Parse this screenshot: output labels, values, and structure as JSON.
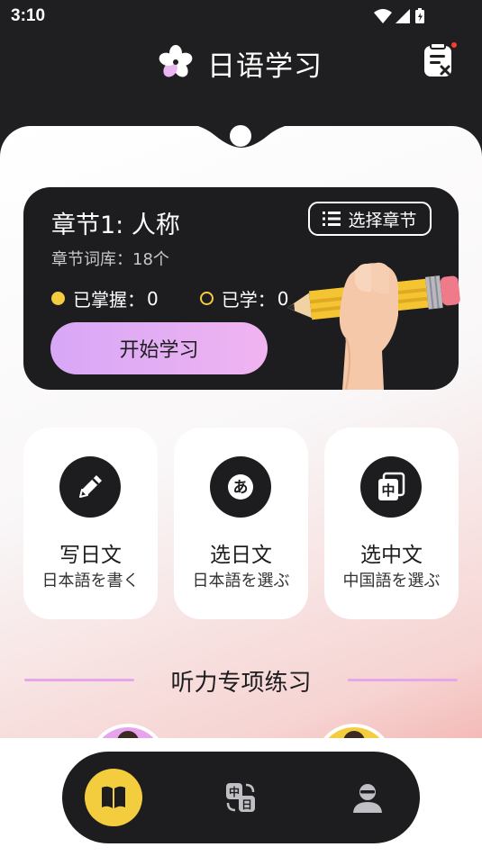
{
  "status_bar": {
    "time": "3:10",
    "icons": [
      "wifi-icon",
      "signal-icon",
      "battery-icon"
    ]
  },
  "header": {
    "title": "日语学习",
    "logo_icon": "flower-icon",
    "right_icon": "notes-icon"
  },
  "chapter_card": {
    "title": "章节1: 人称",
    "select_button_label": "选择章节",
    "word_count_text": "章节词库：18个",
    "mastered_label": "已掌握：",
    "mastered_value": "0",
    "learned_label": "已学：",
    "learned_value": "0",
    "start_button_label": "开始学习"
  },
  "practice_cards": [
    {
      "title": "写日文",
      "subtitle": "日本語を書く",
      "icon": "pencil-icon"
    },
    {
      "title": "选日文",
      "subtitle": "日本語を選ぶ",
      "icon": "hiragana-a-icon"
    },
    {
      "title": "选中文",
      "subtitle": "中国語を選ぶ",
      "icon": "chinese-char-icon"
    }
  ],
  "listening_section": {
    "title": "听力专项练习"
  },
  "bottom_nav": {
    "tabs": [
      {
        "name": "book-icon",
        "active": true
      },
      {
        "name": "translate-icon",
        "active": false
      },
      {
        "name": "profile-icon",
        "active": false
      }
    ]
  },
  "colors": {
    "dark": "#1d1d20",
    "accent_yellow": "#f4cd3e",
    "accent_purple": "#d7a7f7",
    "accent_pink": "#f0b4f0"
  }
}
